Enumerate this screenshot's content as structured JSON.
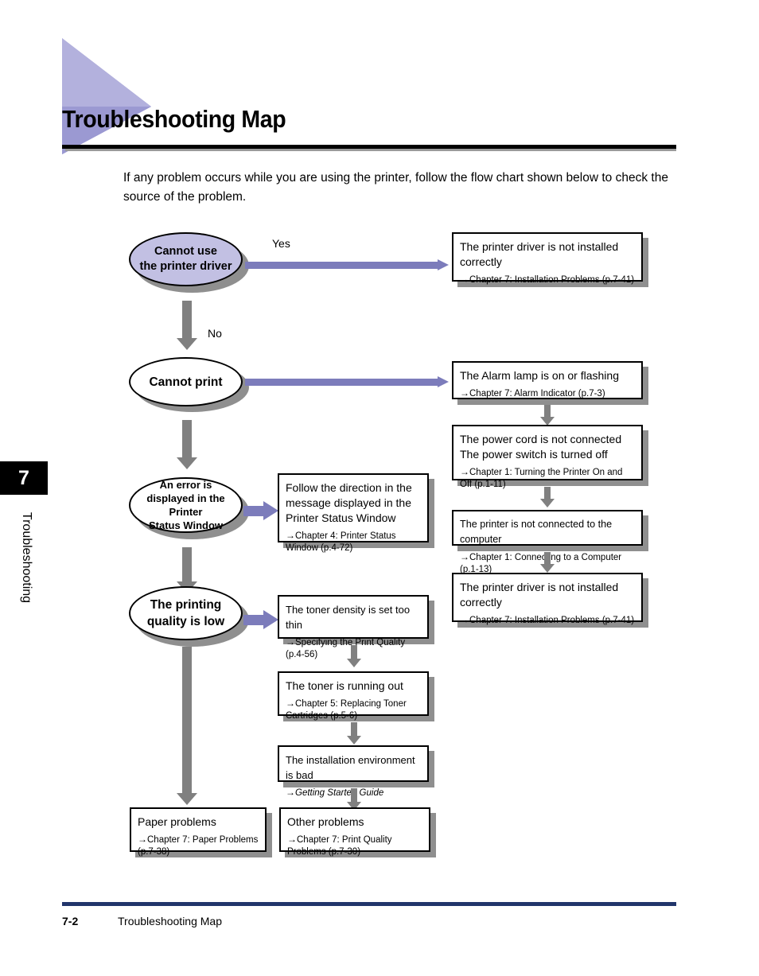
{
  "header": {
    "title": "Troubleshooting Map",
    "triangle_color_light": "#b3b1dd",
    "triangle_color_dark": "#8d8bc9",
    "rule_color": "#000000"
  },
  "intro": {
    "text": "If any problem occurs while you are using the printer, follow the flow chart shown below to check the source of the problem."
  },
  "side_tab": {
    "chapter_number": "7",
    "chapter_label": "Troubleshooting"
  },
  "footer": {
    "page_number": "7-2",
    "section_title": "Troubleshooting Map",
    "rule_color": "#21356b"
  },
  "colors": {
    "purple_arrow": "#7c7cbb",
    "gray_arrow": "#808080",
    "ellipse_fill": "#c2c0e3",
    "shadow": "#8f8f8f"
  },
  "flow": {
    "branch_labels": {
      "yes": "Yes",
      "no": "No"
    },
    "decisions": [
      {
        "id": "cannot-use-driver",
        "text": "Cannot use\nthe printer driver",
        "filled": true
      },
      {
        "id": "cannot-print",
        "text": "Cannot print",
        "filled": false
      },
      {
        "id": "error-displayed",
        "text": "An error is\ndisplayed in the Printer\nStatus Window",
        "filled": false
      },
      {
        "id": "printing-quality-low",
        "text": "The printing\nquality is low",
        "filled": false
      }
    ],
    "boxes": {
      "driver_not_installed_1": {
        "title": "The printer driver is not installed correctly",
        "ref": "Chapter 7: Installation Problems (p.7-41)"
      },
      "alarm_lamp": {
        "title": "The Alarm lamp is on or flashing",
        "ref": "Chapter 7: Alarm Indicator (p.7-3)"
      },
      "power_cord": {
        "title": "The power cord is not connected\nThe power switch is turned off",
        "ref": "Chapter 1: Turning the Printer On and Off (p.1-11)"
      },
      "not_connected": {
        "title": "The printer is not connected to the computer",
        "ref": "Chapter 1: Connecting to a Computer (p.1-13)"
      },
      "driver_not_installed_2": {
        "title": "The printer driver is not installed correctly",
        "ref": "Chapter 7: Installation Problems (p.7-41)"
      },
      "follow_direction": {
        "title": "Follow the direction in the message displayed in the Printer Status Window",
        "ref": "Chapter 4: Printer Status Window (p.4-72)"
      },
      "toner_density": {
        "title": "The toner density is set too thin",
        "ref": "Specifying the Print Quality (p.4-56)"
      },
      "toner_running_out": {
        "title": "The toner is running out",
        "ref": "Chapter 5: Replacing Toner Cartridges (p.5-6)"
      },
      "installation_env": {
        "title": "The installation environment is bad",
        "ref": "Getting Started Guide",
        "ref_italic": true
      },
      "paper_problems": {
        "title": "Paper problems",
        "ref": "Chapter 7: Paper Problems (p.7-38)"
      },
      "other_problems": {
        "title": "Other problems",
        "ref": "Chapter 7: Print Quality Problems (p.7-30)"
      }
    }
  }
}
